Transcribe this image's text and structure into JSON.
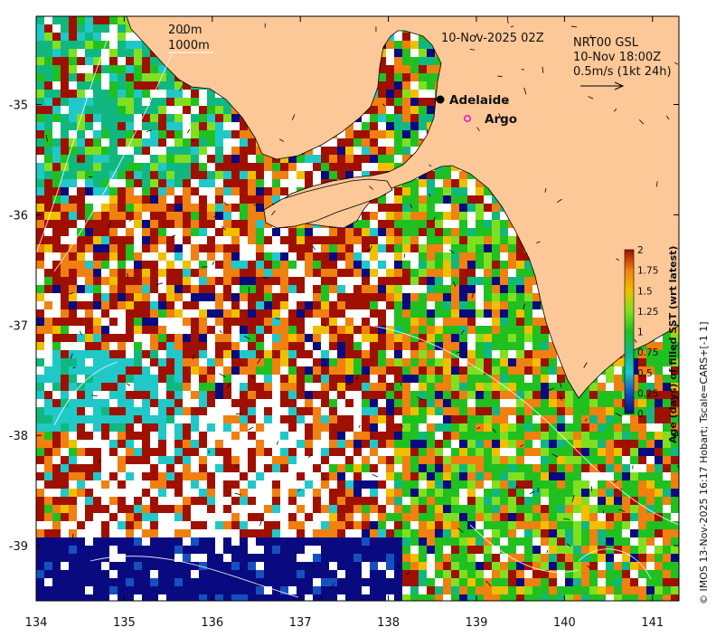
{
  "map": {
    "title": "10-Nov-2025 02Z",
    "product": {
      "line1": "NRT00 GSL",
      "line2": "10-Nov 18:00Z",
      "line3": "0.5m/s (1kt 24h)"
    },
    "isobaths": [
      "200m",
      "1000m"
    ],
    "places": [
      {
        "name": "Adelaide",
        "symbol": "filled-dot",
        "lon": 138.6,
        "lat": -34.93
      },
      {
        "name": "Argo",
        "symbol": "magenta-circle",
        "lon": 138.85,
        "lat": -35.13
      }
    ],
    "credit": "© IMOS 13-Nov-2025 16:17 Hobart; Tscale=CARS+[-1 1]",
    "x_axis": {
      "min": 134,
      "max": 141.3,
      "ticks": [
        "134",
        "135",
        "136",
        "137",
        "138",
        "139",
        "140",
        "141"
      ]
    },
    "y_axis": {
      "min": -39.5,
      "max": -34.2,
      "ticks": [
        "-35",
        "-36",
        "-37",
        "-38",
        "-39"
      ]
    },
    "colorbar": {
      "title": "Age (days) of filled SST (wrt latest)",
      "ticks": [
        "0",
        "0.25",
        "0.5",
        "0.75",
        "1",
        "1.25",
        "1.5",
        "1.75",
        "2"
      ],
      "min": 0,
      "max": 2
    },
    "colors": {
      "land": "#fcc898",
      "no_data": "#ffffff",
      "age_0": "#0a0a80",
      "age_0_25": "#1550c0",
      "age_0_5": "#20c8c8",
      "age_0_75": "#10b880",
      "age_1": "#20c020",
      "age_1_25": "#80e020",
      "age_1_5": "#f0c000",
      "age_1_75": "#f08010",
      "age_2": "#a01000"
    }
  }
}
